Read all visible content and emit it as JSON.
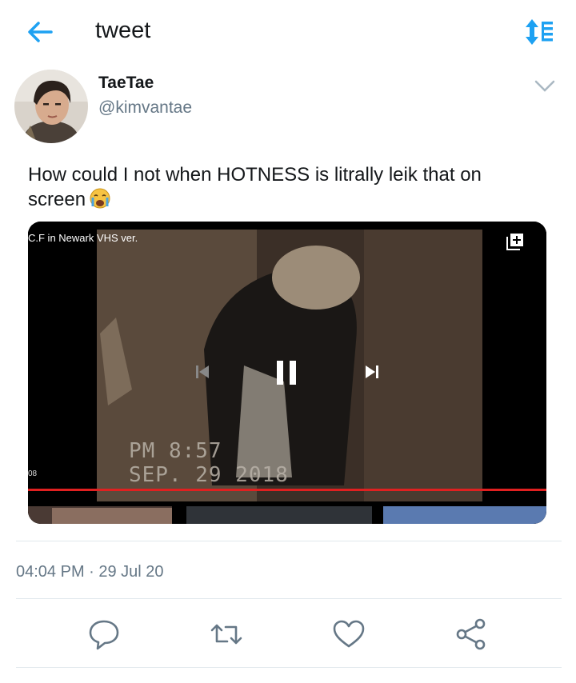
{
  "header": {
    "title": "tweet"
  },
  "author": {
    "name": "TaeTae",
    "handle": "@kimvantae"
  },
  "tweet": {
    "text": "How could I not when HOTNESS is litrally leik that on screen",
    "emoji": "crying-face-emoji"
  },
  "video": {
    "title": "C.F in Newark VHS ver.",
    "current_time": "08",
    "stamp_time": "PM  8:57",
    "stamp_date": "SEP. 29 2018",
    "progress": 1.0,
    "accent": "#e02020"
  },
  "meta": {
    "timestamp": "04:04 PM · 29 Jul 20"
  },
  "colors": {
    "accent": "#1da1f2",
    "muted": "#657786",
    "divider": "#e1e8ed"
  }
}
